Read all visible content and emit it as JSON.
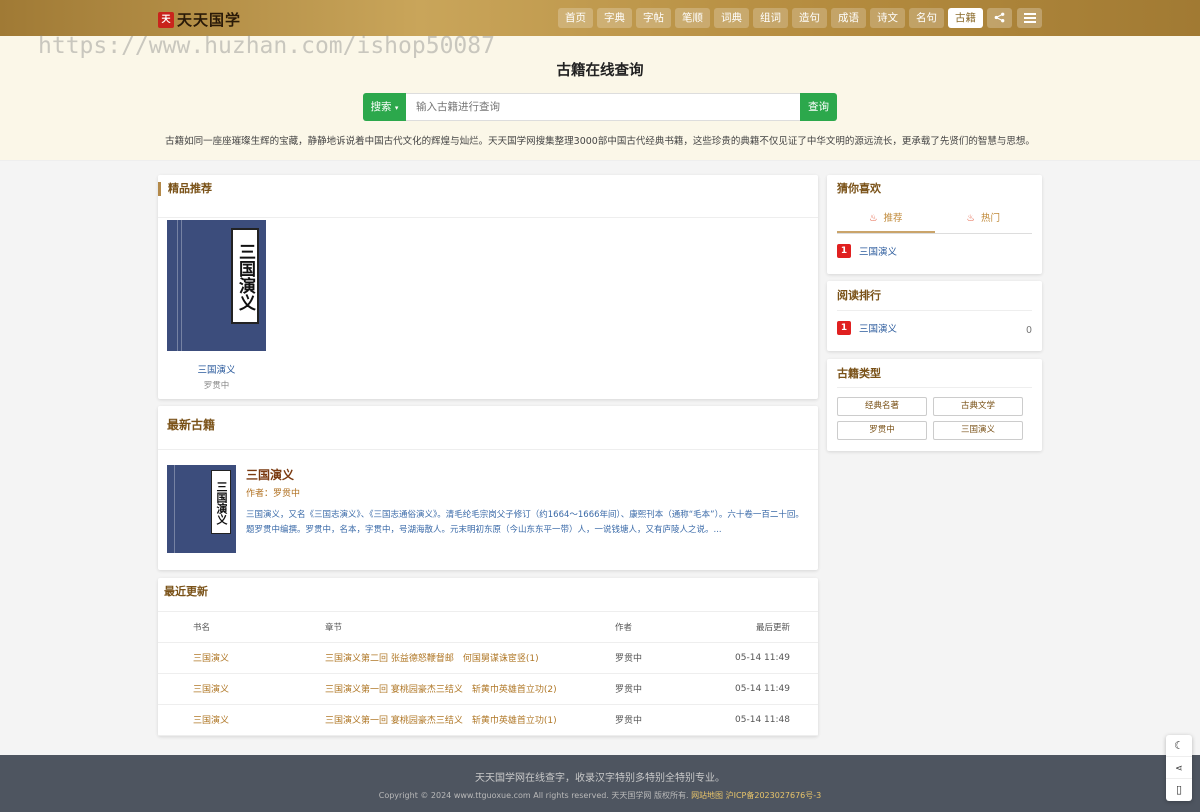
{
  "header": {
    "logo_mark": "天",
    "logo_text": "天天国学",
    "nav": [
      "首页",
      "字典",
      "字帖",
      "笔顺",
      "词典",
      "组词",
      "造句",
      "成语",
      "诗文",
      "名句",
      "古籍"
    ],
    "active_nav": "古籍"
  },
  "watermark": "https://www.huzhan.com/ishop50087",
  "hero": {
    "title": "古籍在线查询",
    "search_type": "搜索",
    "search_placeholder": "输入古籍进行查询",
    "search_button": "查询",
    "desc": "古籍如同一座座璀璨生辉的宝藏，静静地诉说着中国古代文化的辉煌与灿烂。天天国学网搜集整理3000部中国古代经典书籍，这些珍贵的典籍不仅见证了中华文明的源远流长，更承载了先贤们的智慧与思想。"
  },
  "featured": {
    "title": "精品推荐",
    "book": {
      "cover_text": "三国演义",
      "name": "三国演义",
      "author": "罗贯中"
    }
  },
  "latest": {
    "title": "最新古籍",
    "book": {
      "cover_text": "三国演义",
      "name": "三国演义",
      "author": "作者：罗贯中",
      "desc": "三国演义，又名《三国志演义》、《三国志通俗演义》。清毛纶毛宗岗父子修订（约1664～1666年间）、康熙刊本（通称“毛本”）。六十卷一百二十回。　　题罗贯中编撰。罗贯中，名本，字贯中，号湖海散人。元末明初东原（今山东东平一带）人，一说钱塘人，又有庐陵人之说。..."
    }
  },
  "updates": {
    "title": "最近更新",
    "columns": [
      "书名",
      "章节",
      "作者",
      "最后更新"
    ],
    "rows": [
      {
        "book": "三国演义",
        "chapter": "三国演义第二回 张益德怒鞭督邮　何国舅谋诛宦竖(1)",
        "author": "罗贯中",
        "time": "05-14 11:49"
      },
      {
        "book": "三国演义",
        "chapter": "三国演义第一回 宴桃园豪杰三结义　斩黄巾英雄首立功(2)",
        "author": "罗贯中",
        "time": "05-14 11:49"
      },
      {
        "book": "三国演义",
        "chapter": "三国演义第一回 宴桃园豪杰三结义　斩黄巾英雄首立功(1)",
        "author": "罗贯中",
        "time": "05-14 11:48"
      }
    ]
  },
  "guess": {
    "title": "猜你喜欢",
    "tabs": [
      "推荐",
      "热门"
    ],
    "items": [
      {
        "no": "1",
        "name": "三国演义"
      }
    ]
  },
  "ranking": {
    "title": "阅读排行",
    "items": [
      {
        "no": "1",
        "name": "三国演义",
        "count": "0"
      }
    ]
  },
  "types": {
    "title": "古籍类型",
    "tags": [
      "经典名著",
      "古典文学",
      "罗贯中",
      "三国演义"
    ]
  },
  "footer": {
    "line1": "天天国学网在线查字，收录汉字特别多特别全特别专业。",
    "line2_prefix": "Copyright © 2024 www.ttguoxue.com All rights reserved.  天天国学网 版权所有.",
    "sitemap": "网站地图",
    "icp": "沪ICP备2023027676号-3"
  },
  "colors": {
    "brand_gold": "#b48b3e",
    "green": "#2ca84c",
    "rank_red": "#e02020",
    "footer_bg": "#4e5560"
  }
}
